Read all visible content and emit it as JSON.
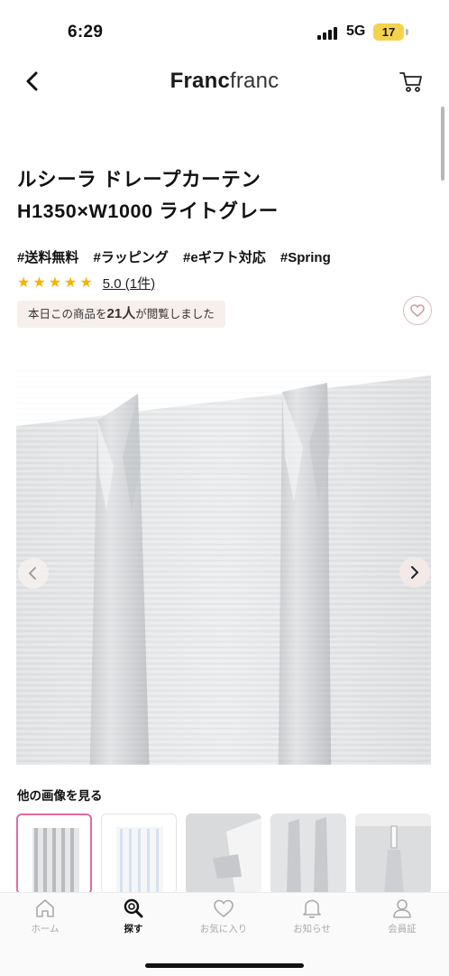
{
  "status_bar": {
    "time": "6:29",
    "network": "5G",
    "battery": "17"
  },
  "header": {
    "brand_bold": "Franc",
    "brand_light": "franc"
  },
  "product": {
    "title_line1": "ルシーラ ドレープカーテン",
    "title_line2": "H1350×W1000 ライトグレー",
    "tags": [
      "#送料無料",
      "#ラッピング",
      "#eギフト対応",
      "#Spring"
    ],
    "stars": "★★★★★",
    "rating_text": "5.0 (1件)",
    "viewed_prefix": "本日この商品を",
    "viewed_count": "21人",
    "viewed_suffix": "が閲覧しました"
  },
  "gallery": {
    "more_label": "他の画像を見る",
    "selected_index": 0
  },
  "tabbar": {
    "items": [
      {
        "label": "ホーム",
        "icon": "home-icon"
      },
      {
        "label": "探す",
        "icon": "search-icon"
      },
      {
        "label": "お気に入り",
        "icon": "heart-icon"
      },
      {
        "label": "お知らせ",
        "icon": "bell-icon"
      },
      {
        "label": "会員証",
        "icon": "member-icon"
      }
    ],
    "active_index": 1
  },
  "colors": {
    "star": "#f4b400",
    "accent_pink": "#e46aa0",
    "viewed_bg": "#f7efec"
  }
}
